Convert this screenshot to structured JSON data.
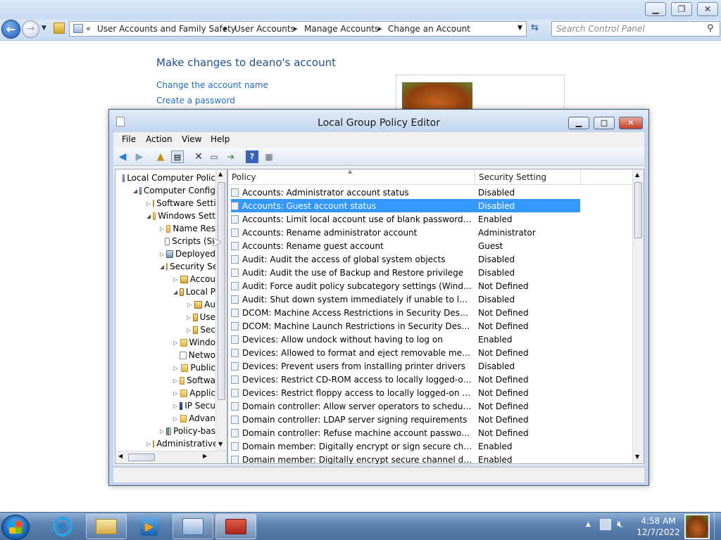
{
  "control_panel": {
    "breadcrumbs": [
      "User Accounts and Family Safety",
      "User Accounts",
      "Manage Accounts",
      "Change an Account"
    ],
    "search_placeholder": "Search Control Panel",
    "heading": "Make changes to deano's account",
    "links": [
      "Change the account name",
      "Create a password"
    ]
  },
  "gpe": {
    "title": "Local Group Policy Editor",
    "menu": [
      "File",
      "Action",
      "View",
      "Help"
    ],
    "tree": [
      {
        "label": "Local Computer Polic",
        "indent": 0,
        "icon": "computer-icon",
        "twisty": ""
      },
      {
        "label": "Computer Config",
        "indent": 1,
        "icon": "computer-icon",
        "twisty": "◢"
      },
      {
        "label": "Software Setti",
        "indent": 2,
        "icon": "folder-icon",
        "twisty": "▷"
      },
      {
        "label": "Windows Sett",
        "indent": 2,
        "icon": "folder-icon",
        "twisty": "◢"
      },
      {
        "label": "Name Res",
        "indent": 3,
        "icon": "folder-icon",
        "twisty": "▷"
      },
      {
        "label": "Scripts (St",
        "indent": 3,
        "icon": "script-icon",
        "twisty": ""
      },
      {
        "label": "Deployed",
        "indent": 3,
        "icon": "printer-icon",
        "twisty": "▷"
      },
      {
        "label": "Security Se",
        "indent": 3,
        "icon": "folder-icon",
        "twisty": "◢"
      },
      {
        "label": "Accou",
        "indent": 4,
        "icon": "lock-folder-icon",
        "twisty": "▷"
      },
      {
        "label": "Local P",
        "indent": 4,
        "icon": "lock-folder-icon",
        "twisty": "◢"
      },
      {
        "label": "Au",
        "indent": 5,
        "icon": "lock-folder-icon",
        "twisty": "▷"
      },
      {
        "label": "Use",
        "indent": 5,
        "icon": "lock-folder-icon",
        "twisty": "▷"
      },
      {
        "label": "Sec",
        "indent": 5,
        "icon": "lock-folder-icon",
        "twisty": "▷"
      },
      {
        "label": "Windo",
        "indent": 4,
        "icon": "folder-icon",
        "twisty": "▷"
      },
      {
        "label": "Netwo",
        "indent": 4,
        "icon": "network-list-icon",
        "twisty": ""
      },
      {
        "label": "Public",
        "indent": 4,
        "icon": "folder-icon",
        "twisty": "▷"
      },
      {
        "label": "Softwa",
        "indent": 4,
        "icon": "folder-icon",
        "twisty": "▷"
      },
      {
        "label": "Applic",
        "indent": 4,
        "icon": "folder-icon",
        "twisty": "▷"
      },
      {
        "label": "IP Secu",
        "indent": 4,
        "icon": "ipsec-icon",
        "twisty": "▷"
      },
      {
        "label": "Advan",
        "indent": 4,
        "icon": "folder-icon",
        "twisty": "▷"
      },
      {
        "label": "Policy-bas",
        "indent": 3,
        "icon": "chart-icon",
        "twisty": "▷"
      },
      {
        "label": "Administrative",
        "indent": 2,
        "icon": "folder-icon",
        "twisty": "▷"
      }
    ],
    "columns": {
      "policy": "Policy",
      "setting": "Security Setting"
    },
    "rows": [
      {
        "policy": "Accounts: Administrator account status",
        "setting": "Disabled"
      },
      {
        "policy": "Accounts: Guest account status",
        "setting": "Disabled",
        "selected": true
      },
      {
        "policy": "Accounts: Limit local account use of blank passwords to co...",
        "setting": "Enabled"
      },
      {
        "policy": "Accounts: Rename administrator account",
        "setting": "Administrator"
      },
      {
        "policy": "Accounts: Rename guest account",
        "setting": "Guest"
      },
      {
        "policy": "Audit: Audit the access of global system objects",
        "setting": "Disabled"
      },
      {
        "policy": "Audit: Audit the use of Backup and Restore privilege",
        "setting": "Disabled"
      },
      {
        "policy": "Audit: Force audit policy subcategory settings (Windows Vis...",
        "setting": "Not Defined"
      },
      {
        "policy": "Audit: Shut down system immediately if unable to log secur...",
        "setting": "Disabled"
      },
      {
        "policy": "DCOM: Machine Access Restrictions in Security Descriptor D...",
        "setting": "Not Defined"
      },
      {
        "policy": "DCOM: Machine Launch Restrictions in Security Descriptor ...",
        "setting": "Not Defined"
      },
      {
        "policy": "Devices: Allow undock without having to log on",
        "setting": "Enabled"
      },
      {
        "policy": "Devices: Allowed to format and eject removable media",
        "setting": "Not Defined"
      },
      {
        "policy": "Devices: Prevent users from installing printer drivers",
        "setting": "Disabled"
      },
      {
        "policy": "Devices: Restrict CD-ROM access to locally logged-on user ...",
        "setting": "Not Defined"
      },
      {
        "policy": "Devices: Restrict floppy access to locally logged-on user only",
        "setting": "Not Defined"
      },
      {
        "policy": "Domain controller: Allow server operators to schedule tasks",
        "setting": "Not Defined"
      },
      {
        "policy": "Domain controller: LDAP server signing requirements",
        "setting": "Not Defined"
      },
      {
        "policy": "Domain controller: Refuse machine account password chan...",
        "setting": "Not Defined"
      },
      {
        "policy": "Domain member: Digitally encrypt or sign secure channel d...",
        "setting": "Enabled"
      },
      {
        "policy": "Domain member: Digitally encrypt secure channel data (wh...",
        "setting": "Enabled"
      }
    ]
  },
  "taskbar": {
    "time": "4:58 AM",
    "date": "12/7/2022"
  }
}
